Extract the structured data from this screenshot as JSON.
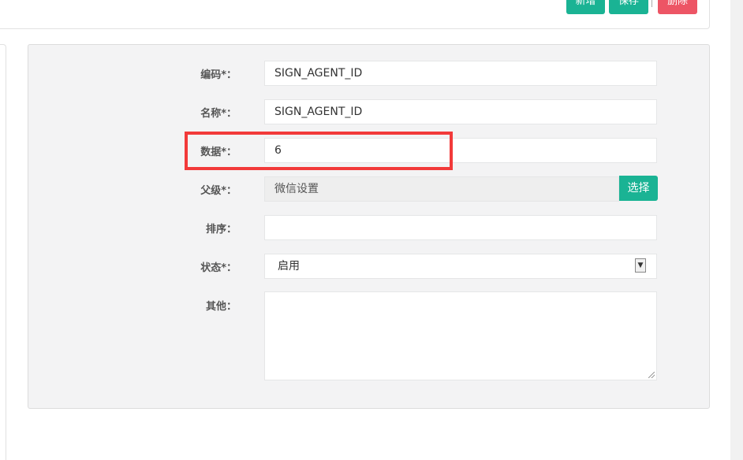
{
  "toolbar": {
    "new_label": "新增",
    "save_label": "保存",
    "delete_label": "删除"
  },
  "form": {
    "code": {
      "label": "编码*：",
      "value": "SIGN_AGENT_ID"
    },
    "name": {
      "label": "名称*：",
      "value": "SIGN_AGENT_ID"
    },
    "data": {
      "label": "数据*：",
      "value": "6"
    },
    "parent": {
      "label": "父级*：",
      "value": "微信设置",
      "button": "选择"
    },
    "sort": {
      "label": "排序：",
      "value": ""
    },
    "status": {
      "label": "状态*：",
      "value": "启用"
    },
    "other": {
      "label": "其他：",
      "value": ""
    }
  },
  "colors": {
    "primary": "#1ab394",
    "danger": "#ed5565",
    "highlight": "#f23a3a"
  }
}
